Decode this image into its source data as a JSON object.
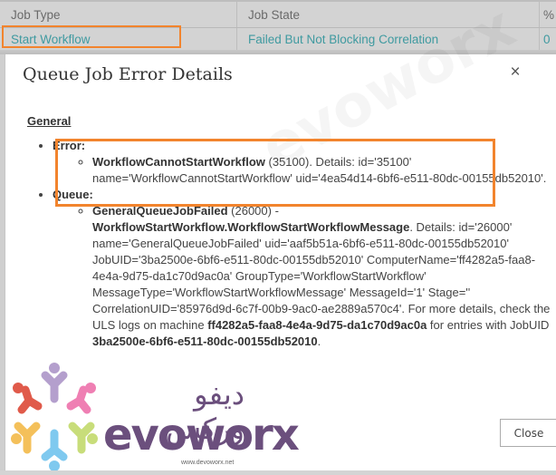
{
  "grid": {
    "columns": [
      "Job Type",
      "Job State",
      "%"
    ],
    "row": {
      "job_type": "Start Workflow",
      "job_state": "Failed But Not Blocking Correlation",
      "percent": "0"
    }
  },
  "dialog": {
    "title": "Queue Job Error Details",
    "close_icon": "×",
    "section_heading": "General",
    "error": {
      "label": "Error:",
      "name": "WorkflowCannotStartWorkflow",
      "text": " (35100). Details: id='35100' name='WorkflowCannotStartWorkflow' uid='4ea54d14-6bf6-e511-80dc-00155db52010'."
    },
    "queue": {
      "label": "Queue:",
      "name": "GeneralQueueJobFailed",
      "code_text": " (26000) - ",
      "message": "WorkflowStartWorkflow.WorkflowStartWorkflowMessage",
      "details": ". Details: id='26000' name='GeneralQueueJobFailed' uid='aaf5b51a-6bf6-e511-80dc-00155db52010' JobUID='3ba2500e-6bf6-e511-80dc-00155db52010' ComputerName='ff4282a5-faa8-4e4a-9d75-da1c70d9ac0a' GroupType='WorkflowStartWorkflow' MessageType='WorkflowStartWorkflowMessage' MessageId='1' Stage='' CorrelationUID='85976d9d-6c7f-00b9-9ac0-ae2889a570c4'. For more details, check the ULS logs on machine ",
      "machine": "ff4282a5-faa8-4e4a-9d75-da1c70d9ac0a",
      "entries_text": " for entries with JobUID ",
      "job_uid": "3ba2500e-6bf6-e511-80dc-00155db52010",
      "end": "."
    },
    "close_button": "Close"
  },
  "watermark": {
    "arabic": "ديفو وركس",
    "brand": "evoworx",
    "url": "www.devoworx.net"
  },
  "colors": {
    "highlight": "#f2842d",
    "link": "#3f9aa0",
    "brand": "#6b4f7d"
  }
}
